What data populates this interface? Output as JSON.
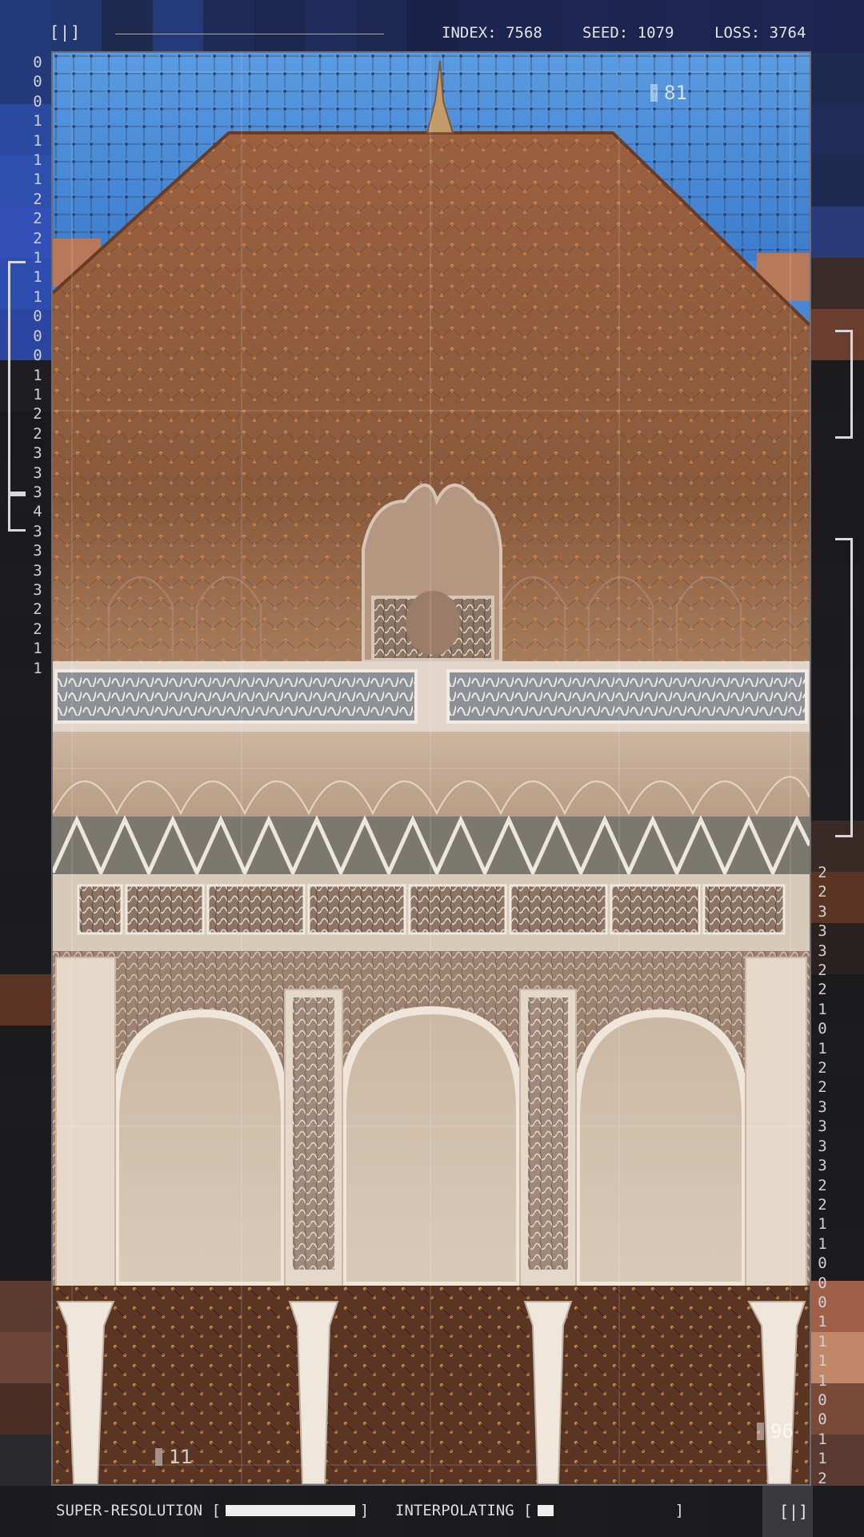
{
  "header": {
    "brackets": "[|]",
    "index_label": "INDEX: 7568",
    "seed_label": "SEED: 1079",
    "loss_label": "LOSS: 3764"
  },
  "markers": {
    "top_right": "81",
    "bottom_left": "11",
    "bottom_right": "96"
  },
  "left_digits": [
    "0",
    "0",
    "0",
    "1",
    "1",
    "1",
    "1",
    "2",
    "2",
    "2",
    "1",
    "1",
    "1",
    "0",
    "0",
    "0",
    "1",
    "1",
    "2",
    "2",
    "3",
    "3",
    "3",
    "4",
    "3",
    "3",
    "3",
    "3",
    "2",
    "2",
    "1",
    "1"
  ],
  "right_digits": [
    "2",
    "2",
    "3",
    "3",
    "3",
    "2",
    "2",
    "1",
    "0",
    "1",
    "2",
    "2",
    "3",
    "3",
    "3",
    "3",
    "2",
    "2",
    "1",
    "1",
    "0",
    "0",
    "0",
    "1",
    "1",
    "1",
    "1",
    "0",
    "0",
    "1",
    "1",
    "2"
  ],
  "footer": {
    "super_resolution_label": "SUPER-RESOLUTION [",
    "super_resolution_close": "]",
    "super_resolution_progress": 1.0,
    "interpolating_label": "INTERPOLATING [",
    "interpolating_close": "]",
    "interpolating_progress": 0.12,
    "brackets": "[|]"
  },
  "colors": {
    "sky": "#4a88d6",
    "dome": "#8a5636",
    "stucco": "#c9b29a",
    "archway": "#d8c8b4",
    "floor": "#5a3524",
    "mesh_dot": "#e08a4a",
    "mesh_line": "#3a3a3e"
  },
  "left_mosaic": [
    "#243a78",
    "#2a4aa0",
    "#2d4fae",
    "#3350b8",
    "#2e4db0",
    "#2a46a0",
    "#1e1e22",
    "#1a1a1c",
    "#1c1c1e",
    "#1b1b1d",
    "#1c1c1e",
    "#1b1b1d",
    "#1c1c1e",
    "#1b1b1d",
    "#1a1a1c",
    "#1c1c1e",
    "#1b1b1d",
    "#1c1c1e",
    "#5a3524",
    "#1b1b1d",
    "#1c1c1e",
    "#1b1b1d",
    "#1a1a1c",
    "#1b1b1d",
    "#5a3a2c",
    "#6b4535",
    "#4a2d24",
    "#2a2a2c",
    "#1b1b1d"
  ],
  "right_mosaic": [
    "#1e2a50",
    "#1f2b58",
    "#1e2a50",
    "#283a78",
    "#3a2a28",
    "#6a3d2e",
    "#1b1b1d",
    "#1c1c1e",
    "#1b1b1d",
    "#1a1a1c",
    "#1c1c1e",
    "#1b1b1d",
    "#1c1c1e",
    "#1b1b1d",
    "#1c1c1e",
    "#3a2a26",
    "#5a3524",
    "#2a2220",
    "#1b1b1d",
    "#1c1c1e",
    "#1b1b1d",
    "#1c1c1e",
    "#1b1b1d",
    "#1c1c1e",
    "#a06048",
    "#c08868",
    "#7a4a38",
    "#5a3a30",
    "#4a3028"
  ],
  "top_mosaic": [
    "#243a78",
    "#223670",
    "#1e2a50",
    "#253a7a",
    "#1e2a58",
    "#1c2850",
    "#202c5c",
    "#1d2952",
    "#1b2248",
    "#1c2450",
    "#1c2450",
    "#1d2652",
    "#1c2450",
    "#1d2652",
    "#1c2450",
    "#1d2652",
    "#1c2450"
  ]
}
